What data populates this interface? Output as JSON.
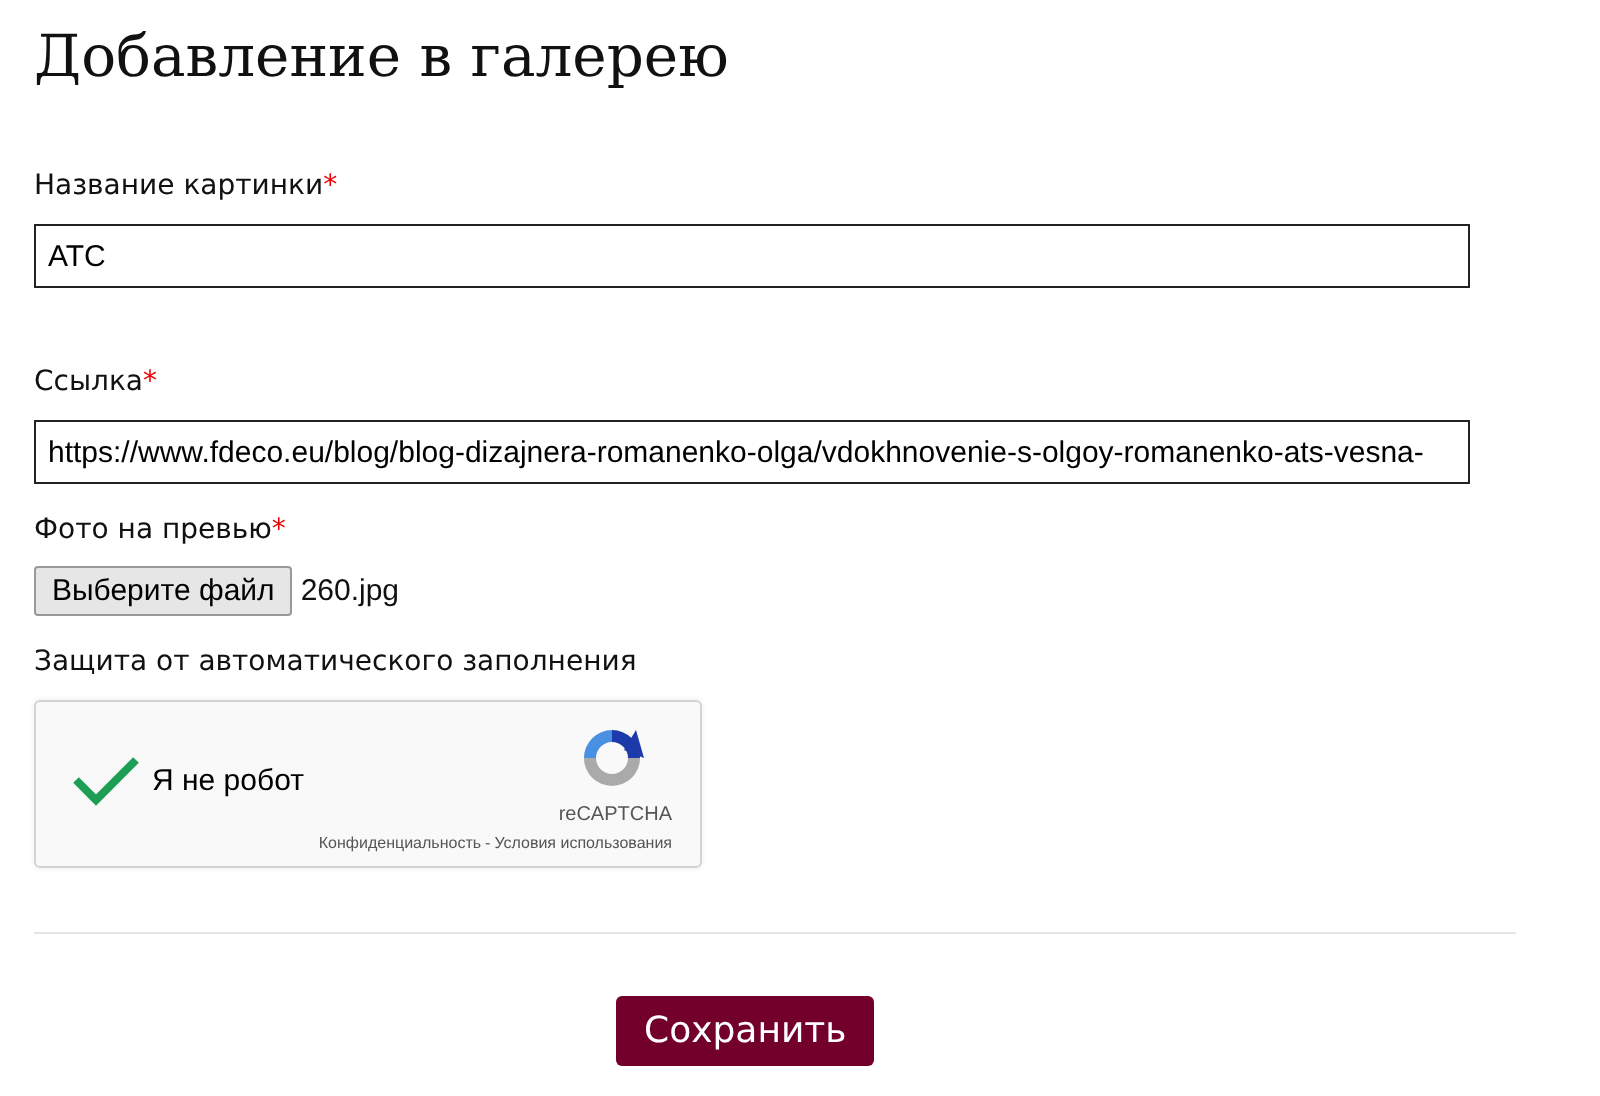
{
  "title": "Добавление в галерею",
  "fields": [
    {
      "kind": "text",
      "label": "Название картинки",
      "required_mark": "*",
      "value": "АТС"
    },
    {
      "kind": "text",
      "label": "Ссылка",
      "required_mark": "*",
      "value": "https://www.fdeco.eu/blog/blog-dizajnera-romanenko-olga/vdokhnovenie-s-olgoy-romanenko-ats-vesna-"
    },
    {
      "kind": "file",
      "label": "Фото на превью",
      "required_mark": "*",
      "button": "Выберите файл",
      "file_name": "260.jpg"
    },
    {
      "kind": "captcha",
      "label": "Защита от автоматического заполнения",
      "checked": true,
      "text": "Я не робот",
      "brand": "reCAPTCHA",
      "privacy_link": "Конфиденциальность",
      "separator": "-",
      "terms_link": "Условия использования"
    }
  ],
  "submit": "Сохранить"
}
